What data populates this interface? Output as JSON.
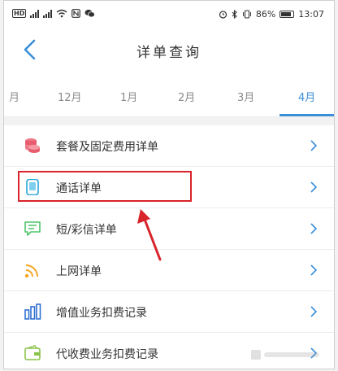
{
  "status_bar": {
    "hd_label": "HD",
    "battery_percent": "86%",
    "time": "13:07"
  },
  "header": {
    "title": "详单查询"
  },
  "month_tabs": [
    {
      "label": "月",
      "active": false
    },
    {
      "label": "12月",
      "active": false
    },
    {
      "label": "1月",
      "active": false
    },
    {
      "label": "2月",
      "active": false
    },
    {
      "label": "3月",
      "active": false
    },
    {
      "label": "4月",
      "active": true
    }
  ],
  "list_items": [
    {
      "label": "套餐及固定费用详单",
      "icon": "coins-icon"
    },
    {
      "label": "通话详单",
      "icon": "phone-icon"
    },
    {
      "label": "短/彩信详单",
      "icon": "message-icon"
    },
    {
      "label": "上网详单",
      "icon": "wifi-signal-icon"
    },
    {
      "label": "增值业务扣费记录",
      "icon": "bar-chart-icon"
    },
    {
      "label": "代收费业务扣费记录",
      "icon": "wallet-icon"
    }
  ],
  "colors": {
    "accent": "#3a8fd9",
    "highlight": "#d8232a"
  }
}
